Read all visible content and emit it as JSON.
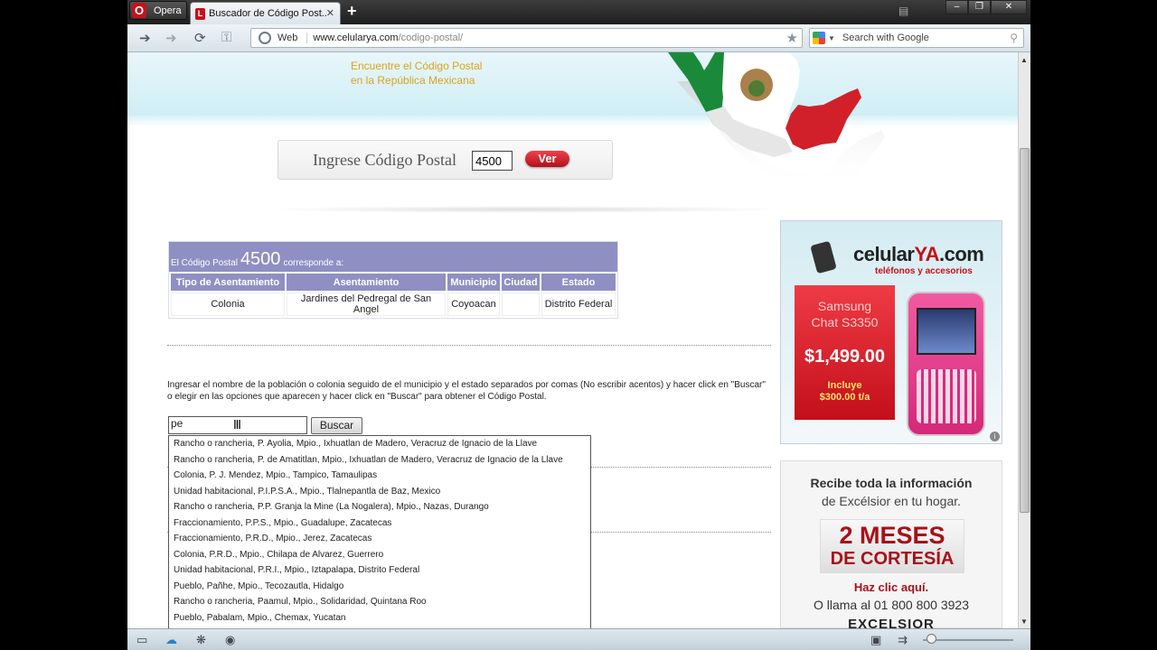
{
  "browser": {
    "menu_label": "Opera",
    "tab_title": "Buscador de Código Post...",
    "tab_close": "✕",
    "new_tab": "+",
    "address_scheme_label": "Web",
    "address_domain": "www.celularya.com",
    "address_path": "/codigo-postal/",
    "search_placeholder": "Search with Google"
  },
  "header": {
    "tagline_line1": "Encuentre el Código Postal",
    "tagline_line2": "en la República Mexicana"
  },
  "cp_search": {
    "label": "Ingrese Código Postal",
    "value": "4500",
    "button": "Ver"
  },
  "results": {
    "caption_prefix": "El Código Postal",
    "code": "4500",
    "caption_suffix": "corresponde a:",
    "columns": [
      "Tipo de Asentamiento",
      "Asentamiento",
      "Municipio",
      "Ciudad",
      "Estado"
    ],
    "rows": [
      [
        "Colonia",
        "Jardines del Pedregal de San Angel",
        "Coyoacan",
        "",
        "Distrito Federal"
      ]
    ]
  },
  "instructions": "Ingresar el nombre de la población o colonia seguido de el municipio y el estado separados por comas (No escribir acentos) y hacer click en \"Buscar\" o elegir en las opciones que aparecen y hacer click en \"Buscar\" para obtener el Código Postal.",
  "place_search": {
    "value": "pe",
    "button": "Buscar",
    "suggestions": [
      "Rancho o rancheria, P. Ayolia, Mpio., Ixhuatlan de Madero, Veracruz de Ignacio de la Llave",
      "Rancho o rancheria, P. de Amatitlan, Mpio., Ixhuatlan de Madero, Veracruz de Ignacio de la Llave",
      "Colonia, P. J. Mendez, Mpio., Tampico, Tamaulipas",
      "Unidad habitacional, P.I.P.S.A., Mpio., Tlalnepantla de Baz, Mexico",
      "Rancho o rancheria, P.P. Granja la Mine (La Nogalera), Mpio., Nazas, Durango",
      "Fraccionamiento, P.P.S., Mpio., Guadalupe, Zacatecas",
      "Fraccionamiento, P.R.D., Mpio., Jerez, Zacatecas",
      "Colonia, P.R.D., Mpio., Chilapa de Alvarez, Guerrero",
      "Unidad habitacional, P.R.I., Mpio., Iztapalapa, Distrito Federal",
      "Pueblo, Pañhe, Mpio., Tecozautla, Hidalgo",
      "Rancho o rancheria, Paamul, Mpio., Solidaridad, Quintana Roo",
      "Pueblo, Pabalam, Mpio., Chemax, Yucatan"
    ]
  },
  "ad_celular": {
    "brand_a": "celular",
    "brand_b": "YA",
    "brand_c": ".com",
    "subtitle": "teléfonos y accesorios",
    "model_line1": "Samsung",
    "model_line2": "Chat S3350",
    "price": "$1,499.00",
    "includes_line1": "Incluye",
    "includes_line2": "$300.00 t/a"
  },
  "ad_excelsior": {
    "line1": "Recibe toda la información",
    "line2": "de Excélsior en tu hogar.",
    "big1": "2 MESES",
    "big2": "DE CORTESÍA",
    "cta": "Haz clic aquí.",
    "phone": "O llama al  01 800 800 3923",
    "brand": "EXCELSIOR"
  },
  "icons": {
    "back": "back-arrow-icon",
    "forward": "forward-arrow-icon",
    "reload": "reload-icon",
    "key": "key-icon",
    "bookmark": "star-icon",
    "search": "search-icon"
  },
  "colors": {
    "table_header": "#8f8fc4",
    "tagline": "#d9a31c",
    "ver_button": "#d01a24",
    "ad_red": "#c41016"
  }
}
